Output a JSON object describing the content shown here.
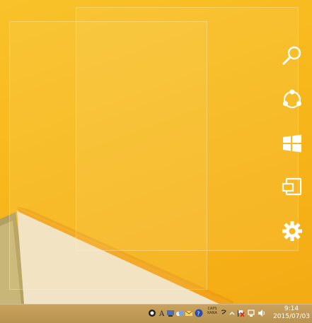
{
  "charms": [
    {
      "id": "search",
      "label": "",
      "icon": "search-icon"
    },
    {
      "id": "share",
      "label": "",
      "icon": "share-icon"
    },
    {
      "id": "start",
      "label": "",
      "icon": "windows-logo-icon"
    },
    {
      "id": "devices",
      "label": "",
      "icon": "devices-icon"
    },
    {
      "id": "settings",
      "label": "",
      "icon": "gear-icon"
    }
  ],
  "taskbar": {
    "tray_icons": [
      "app-icon",
      "text-services-icon",
      "network-app-icon",
      "cloud-app-icon",
      "mail-app-icon",
      "help-icon"
    ],
    "ime": {
      "line1": "CAPS",
      "line2": "KANA"
    },
    "clock": {
      "time": "9:14",
      "date": "2015/07/03"
    }
  },
  "colors": {
    "wallpaper": "#f7b81b",
    "taskbar": "#c1994f",
    "charm_icon": "#ffffff"
  }
}
